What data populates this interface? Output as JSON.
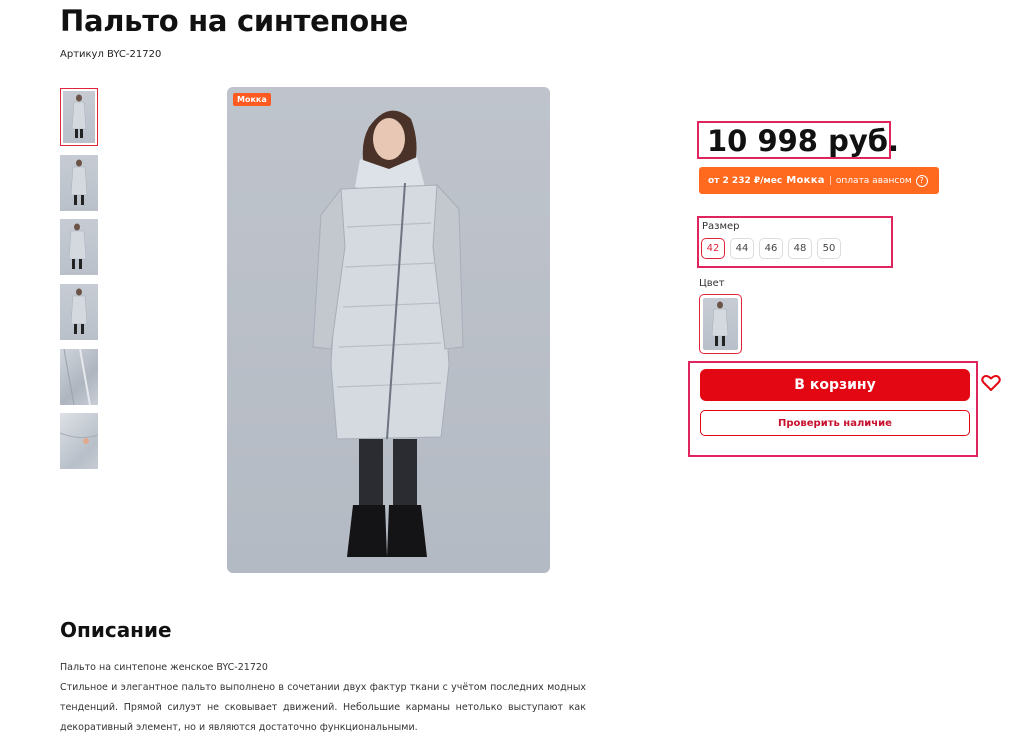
{
  "product": {
    "title": "Пальто на синтепоне",
    "sku": "Артикул BYC-21720"
  },
  "gallery": {
    "badge": "Мокка",
    "thumbnail_count": 6,
    "active_thumbnail": 1
  },
  "pricing": {
    "price": "10 998 руб.",
    "installment": {
      "amount": "от 2 232 ₽/мес",
      "brand": "Мокка",
      "separator": "|",
      "note": "оплата авансом",
      "help": "?"
    }
  },
  "size_selector": {
    "label": "Размер",
    "options": [
      "42",
      "44",
      "46",
      "48",
      "50"
    ],
    "selected": "42"
  },
  "color_selector": {
    "label": "Цвет"
  },
  "actions": {
    "add_to_cart": "В корзину",
    "check_availability": "Проверить наличие",
    "favorite_icon": "heart-icon"
  },
  "description": {
    "heading": "Описание",
    "line1": "Пальто на синтепоне женское BYC-21720",
    "line2": "Стильное и элегантное пальто выполнено в сочетании двух фактур ткани с учётом последних модных тенденций. Прямой силуэт не сковывает движений. Небольшие карманы нетолько выступают как декоративный элемент, но и являются достаточно функциональными."
  },
  "colors": {
    "accent": "#e30613",
    "highlight_border": "#e0245e",
    "mokka_orange": "#ff6a1f",
    "coat_gray": "#bfc4cc"
  }
}
